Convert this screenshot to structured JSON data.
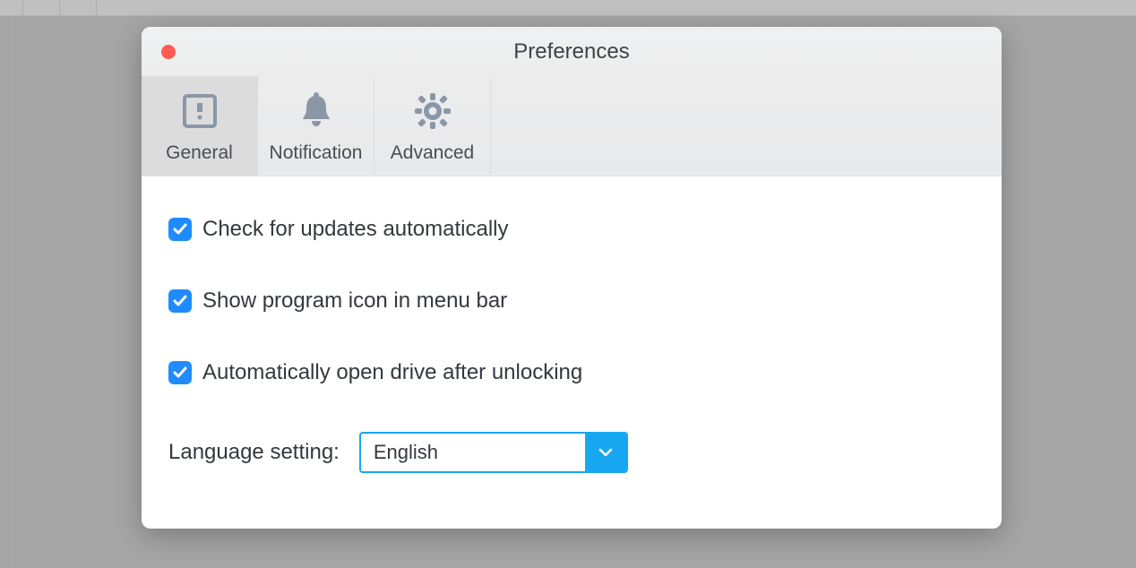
{
  "window": {
    "title": "Preferences"
  },
  "tabs": [
    {
      "label": "General",
      "active": true
    },
    {
      "label": "Notification",
      "active": false
    },
    {
      "label": "Advanced",
      "active": false
    }
  ],
  "options": {
    "check_updates": {
      "label": "Check for updates automatically",
      "checked": true
    },
    "show_menu_icon": {
      "label": "Show program icon in menu bar",
      "checked": true
    },
    "auto_open_drive": {
      "label": "Automatically open drive after unlocking",
      "checked": true
    }
  },
  "language": {
    "label": "Language setting:",
    "selected": "English"
  }
}
